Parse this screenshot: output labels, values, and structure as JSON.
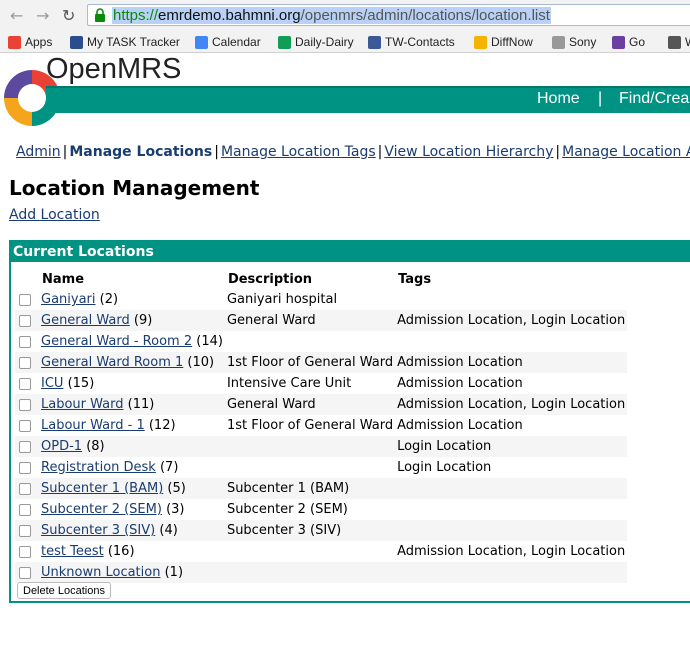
{
  "browser": {
    "url_scheme": "https://",
    "url_host": "emrdemo.bahmni.org",
    "url_path": "/openmrs/admin/locations/location.list",
    "bookmarks": [
      {
        "label": "Apps",
        "icon": "apps-grid-icon",
        "color": "#e94235"
      },
      {
        "label": "My TASK Tracker",
        "icon": "tracker-icon",
        "color": "#2a4d8f"
      },
      {
        "label": "Calendar",
        "icon": "calendar-icon",
        "color": "#4285f4"
      },
      {
        "label": "Daily-Dairy",
        "icon": "sheet-icon",
        "color": "#0f9d58"
      },
      {
        "label": "TW-Contacts",
        "icon": "contacts-icon",
        "color": "#3b5998"
      },
      {
        "label": "DiffNow",
        "icon": "diffnow-icon",
        "color": "#f4b400"
      },
      {
        "label": "Sony",
        "icon": "folder-icon",
        "color": "#999999"
      },
      {
        "label": "Go",
        "icon": "go-icon",
        "color": "#6a3fa0"
      },
      {
        "label": "W",
        "icon": "wiki-icon",
        "color": "#555555"
      }
    ]
  },
  "header": {
    "logo_text": "OpenMRS",
    "nav_home": "Home",
    "nav_sep": "|",
    "nav_find": "Find/Crea",
    "accent": "#009384"
  },
  "adminnav": {
    "admin": "Admin",
    "manage_locations": "Manage Locations",
    "manage_tags": "Manage Location Tags",
    "view_hierarchy": "View Location Hierarchy",
    "manage_attr": "Manage Location A"
  },
  "page": {
    "title": "Location Management",
    "add_location": "Add Location",
    "box_title": "Current Locations",
    "delete_button": "Delete Locations"
  },
  "table": {
    "headers": {
      "name": "Name",
      "description": "Description",
      "tags": "Tags"
    },
    "rows": [
      {
        "name": "Ganiyari",
        "count": "(2)",
        "description": "Ganiyari hospital",
        "tags": ""
      },
      {
        "name": "General Ward",
        "count": "(9)",
        "description": "General Ward",
        "tags": "Admission Location, Login Location"
      },
      {
        "name": "General Ward - Room 2",
        "count": "(14)",
        "description": "",
        "tags": ""
      },
      {
        "name": "General Ward Room 1",
        "count": "(10)",
        "description": "1st Floor of General Ward",
        "tags": "Admission Location"
      },
      {
        "name": "ICU",
        "count": "(15)",
        "description": "Intensive Care Unit",
        "tags": "Admission Location"
      },
      {
        "name": "Labour Ward",
        "count": "(11)",
        "description": "General Ward",
        "tags": "Admission Location, Login Location"
      },
      {
        "name": "Labour Ward - 1",
        "count": "(12)",
        "description": "1st Floor of General Ward",
        "tags": "Admission Location"
      },
      {
        "name": "OPD-1",
        "count": "(8)",
        "description": "",
        "tags": "Login Location"
      },
      {
        "name": "Registration Desk",
        "count": "(7)",
        "description": "",
        "tags": "Login Location"
      },
      {
        "name": "Subcenter 1 (BAM)",
        "count": "(5)",
        "description": "Subcenter 1 (BAM)",
        "tags": ""
      },
      {
        "name": "Subcenter 2 (SEM)",
        "count": "(3)",
        "description": "Subcenter 2 (SEM)",
        "tags": ""
      },
      {
        "name": "Subcenter 3 (SIV)",
        "count": "(4)",
        "description": "Subcenter 3 (SIV)",
        "tags": ""
      },
      {
        "name": "test Teest",
        "count": "(16)",
        "description": "",
        "tags": "Admission Location, Login Location"
      },
      {
        "name": "Unknown Location",
        "count": "(1)",
        "description": "",
        "tags": ""
      }
    ]
  }
}
